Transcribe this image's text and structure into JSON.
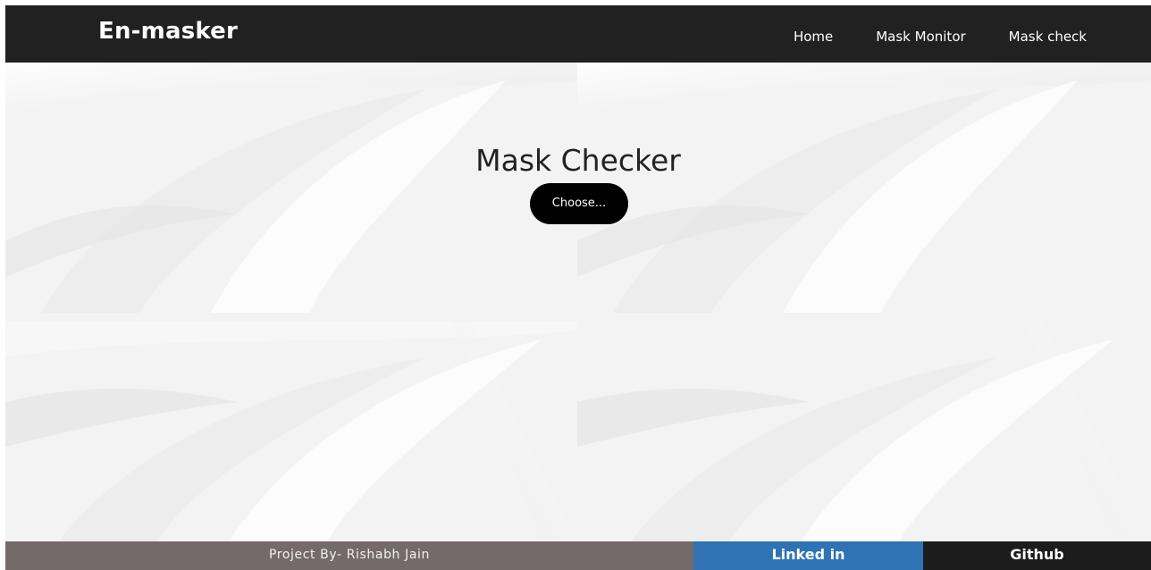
{
  "navbar": {
    "brand": "En-masker",
    "links": [
      {
        "label": "Home"
      },
      {
        "label": "Mask Monitor"
      },
      {
        "label": "Mask check"
      }
    ]
  },
  "main": {
    "title": "Mask Checker",
    "choose_label": "Choose..."
  },
  "footer": {
    "credit": "Project By- Rishabh Jain",
    "linkedin": "Linked in",
    "github": "Github"
  },
  "colors": {
    "navbar_bg": "#212121",
    "footer_credit_bg": "#746a6a",
    "footer_linkedin_bg": "#2f73b4",
    "footer_github_bg": "#1c1c1c",
    "button_bg": "#000000"
  }
}
